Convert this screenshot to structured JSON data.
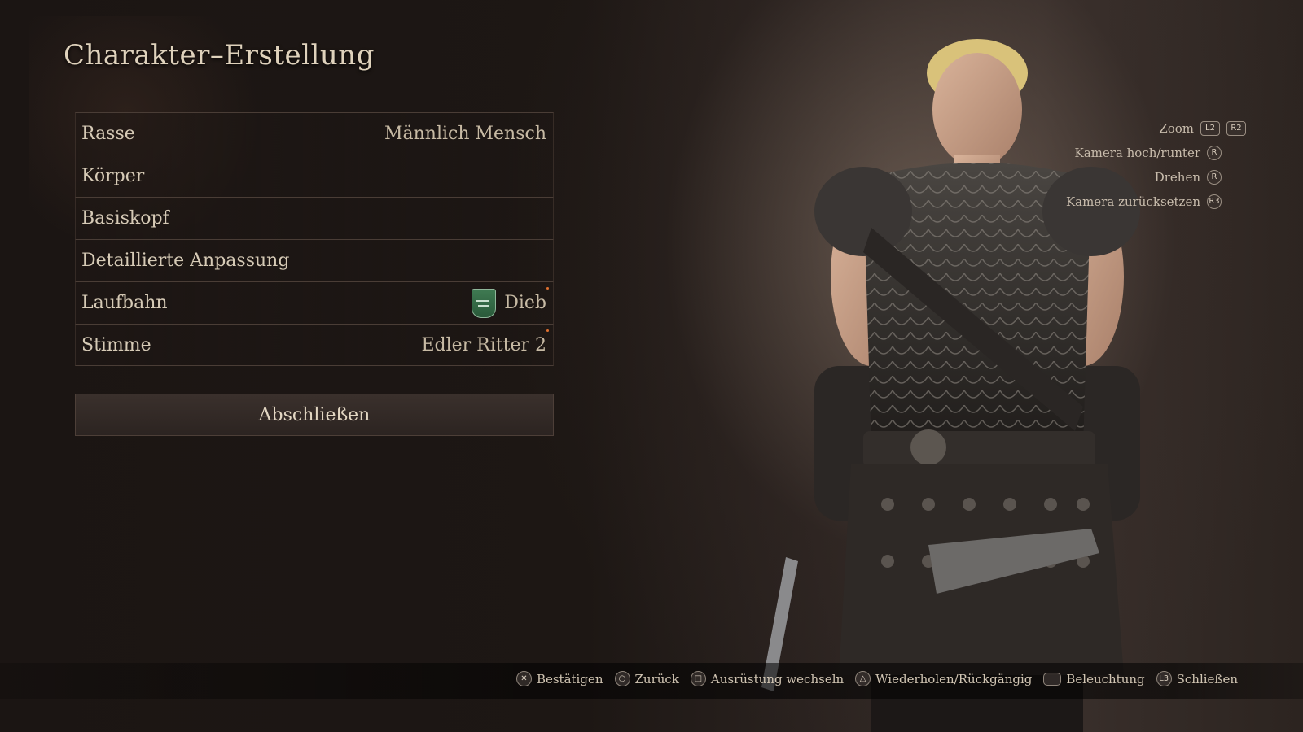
{
  "title": "Charakter–Erstellung",
  "menu": [
    {
      "label": "Rasse",
      "value": "Männlich Mensch"
    },
    {
      "label": "Körper",
      "value": ""
    },
    {
      "label": "Basiskopf",
      "value": ""
    },
    {
      "label": "Detaillierte Anpassung",
      "value": ""
    },
    {
      "label": "Laufbahn",
      "value": "Dieb",
      "icon": "thief-vocation-shield-icon"
    },
    {
      "label": "Stimme",
      "value": "Edler Ritter 2"
    }
  ],
  "finish_label": "Abschließen",
  "camera_controls": [
    {
      "label": "Zoom",
      "buttons": [
        "L2",
        "R2"
      ]
    },
    {
      "label": "Kamera hoch/runter",
      "buttons": [
        "R"
      ]
    },
    {
      "label": "Drehen",
      "buttons": [
        "R"
      ]
    },
    {
      "label": "Kamera zurücksetzen",
      "buttons": [
        "R3"
      ]
    }
  ],
  "footer": [
    {
      "icon": "cross-button-icon",
      "glyph": "✕",
      "label": "Bestätigen"
    },
    {
      "icon": "circle-button-icon",
      "glyph": "○",
      "label": "Zurück"
    },
    {
      "icon": "square-button-icon",
      "glyph": "□",
      "label": "Ausrüstung wechseln"
    },
    {
      "icon": "triangle-button-icon",
      "glyph": "△",
      "label": "Wiederholen/Rückgängig"
    },
    {
      "icon": "touchpad-button-icon",
      "glyph": "",
      "label": "Beleuchtung"
    },
    {
      "icon": "l3-button-icon",
      "glyph": "L3",
      "label": "Schließen"
    }
  ],
  "colors": {
    "accent_dot": "#e07030",
    "vocation_green": "#3f7a52"
  }
}
